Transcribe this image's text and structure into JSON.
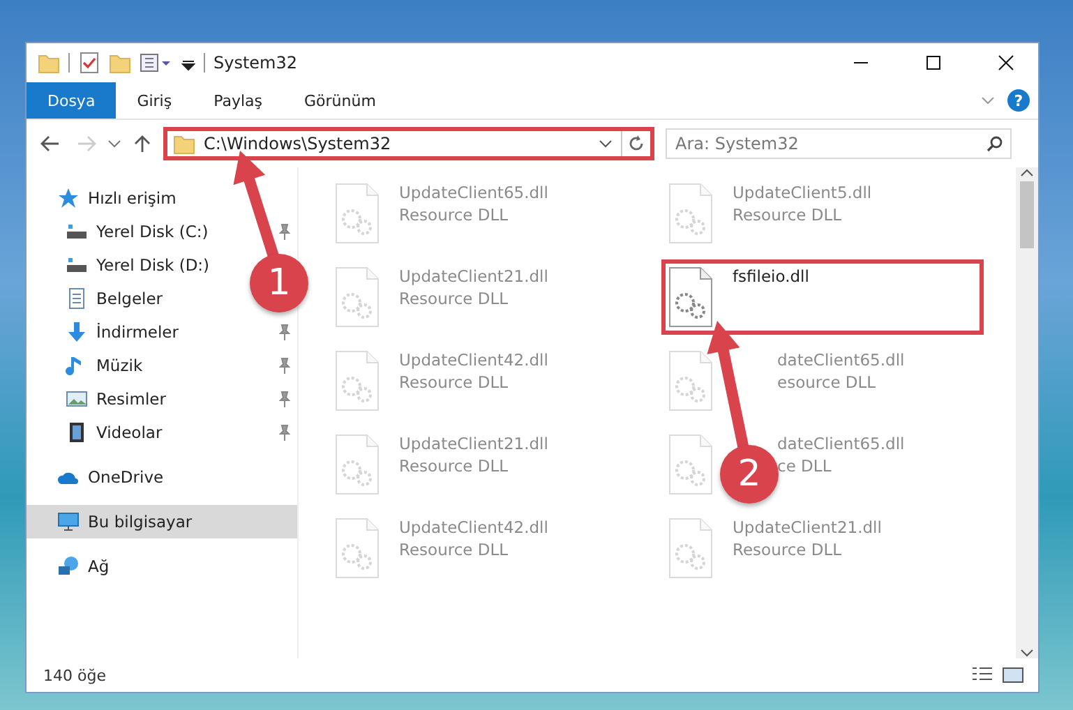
{
  "window": {
    "title": "System32"
  },
  "ribbon": {
    "tabs": [
      {
        "label": "Dosya",
        "kind": "file"
      },
      {
        "label": "Giriş",
        "kind": "tab"
      },
      {
        "label": "Paylaş",
        "kind": "tab"
      },
      {
        "label": "Görünüm",
        "kind": "tab"
      }
    ],
    "help": "?"
  },
  "address": {
    "path": "C:\\Windows\\System32",
    "highlighted": true
  },
  "search": {
    "placeholder": "Ara: System32"
  },
  "sidebar": {
    "items": [
      {
        "label": "Hızlı erişim",
        "kind": "star",
        "selected": false,
        "children": [
          {
            "label": "Yerel Disk (C:)",
            "kind": "drive",
            "pinned": true,
            "selected": false
          },
          {
            "label": "Yerel Disk (D:)",
            "kind": "drive",
            "pinned": false,
            "selected": false
          },
          {
            "label": "Belgeler",
            "kind": "document",
            "pinned": false,
            "selected": false
          },
          {
            "label": "İndirmeler",
            "kind": "download",
            "pinned": true,
            "selected": false
          },
          {
            "label": "Müzik",
            "kind": "music",
            "pinned": true,
            "selected": false
          },
          {
            "label": "Resimler",
            "kind": "picture",
            "pinned": true,
            "selected": false
          },
          {
            "label": "Videolar",
            "kind": "video",
            "pinned": true,
            "selected": false
          }
        ]
      },
      {
        "label": "OneDrive",
        "kind": "cloud",
        "selected": false
      },
      {
        "label": "Bu bilgisayar",
        "kind": "computer",
        "selected": true
      },
      {
        "label": "Ağ",
        "kind": "network",
        "selected": false
      }
    ]
  },
  "files": [
    {
      "name": "UpdateClient65.dll",
      "type": "Resource DLL",
      "dimmed": true,
      "highlighted": false,
      "covered": false
    },
    {
      "name": "UpdateClient5.dll",
      "type": "Resource DLL",
      "dimmed": true,
      "highlighted": false,
      "covered": false
    },
    {
      "name": "UpdateClient21.dll",
      "type": "Resource DLL",
      "dimmed": true,
      "highlighted": false,
      "covered": false
    },
    {
      "name": "fsfileio.dll",
      "dimmed": false,
      "highlighted": true,
      "covered": false
    },
    {
      "name": "UpdateClient42.dll",
      "type": "Resource DLL",
      "dimmed": true,
      "highlighted": false,
      "covered": false
    },
    {
      "name": "dateClient65.dll",
      "type": "esource DLL",
      "dimmed": true,
      "highlighted": false,
      "covered": true
    },
    {
      "name": "UpdateClient21.dll",
      "type": "Resource DLL",
      "dimmed": true,
      "highlighted": false,
      "covered": false
    },
    {
      "name": "dateClient65.dll",
      "type": "ce DLL",
      "dimmed": true,
      "highlighted": false,
      "covered": true
    },
    {
      "name": "UpdateClient42.dll",
      "type": "Resource DLL",
      "dimmed": true,
      "highlighted": false,
      "covered": false
    },
    {
      "name": "UpdateClient21.dll",
      "type": "Resource DLL",
      "dimmed": true,
      "highlighted": false,
      "covered": false
    }
  ],
  "status_bar": {
    "count": "140 öğe"
  },
  "annotations": [
    {
      "number": "1"
    },
    {
      "number": "2"
    }
  ]
}
